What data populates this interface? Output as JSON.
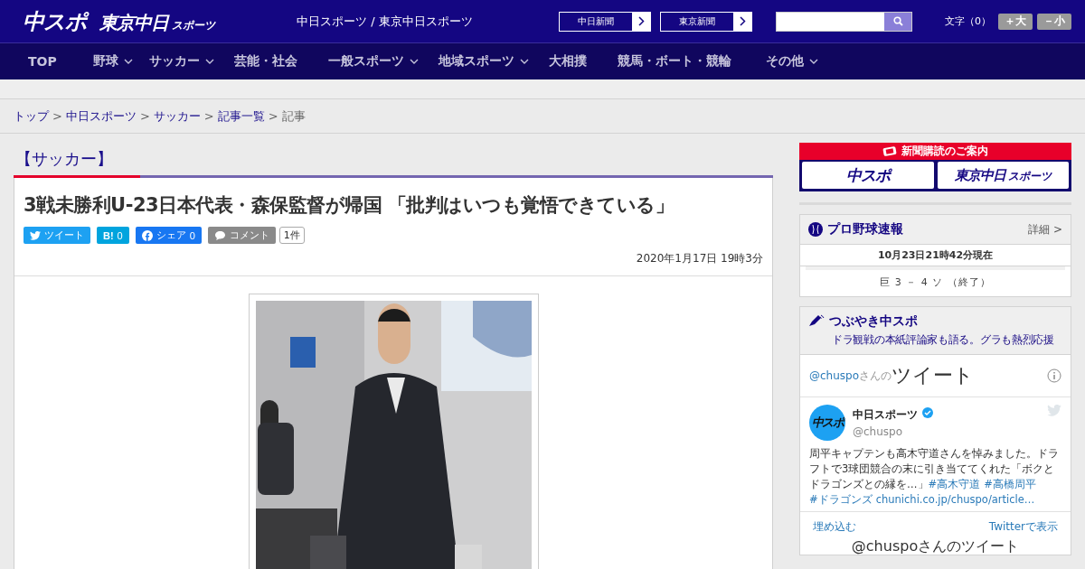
{
  "header": {
    "logos": [
      {
        "main": "中スポ"
      },
      {
        "main": "東京中日",
        "sub": "スポーツ"
      }
    ],
    "site_title": "中日スポーツ / 東京中日スポーツ",
    "paper_links": [
      "中日新聞",
      "東京新聞"
    ],
    "font_size": {
      "label": "文字（0）",
      "buttons": [
        "＋大",
        "－小"
      ]
    }
  },
  "nav": [
    {
      "label": "TOP",
      "dropdown": false
    },
    {
      "label": "野球",
      "dropdown": true
    },
    {
      "label": "サッカー",
      "dropdown": true
    },
    {
      "label": "芸能・社会",
      "dropdown": false
    },
    {
      "label": "一般スポーツ",
      "dropdown": true
    },
    {
      "label": "地域スポーツ",
      "dropdown": true
    },
    {
      "label": "大相撲",
      "dropdown": false
    },
    {
      "label": "競馬・ボート・競輪",
      "dropdown": false
    },
    {
      "label": "その他",
      "dropdown": true
    }
  ],
  "breadcrumb": {
    "separator": ">",
    "items": [
      {
        "label": "トップ",
        "link": true
      },
      {
        "label": "中日スポーツ",
        "link": true
      },
      {
        "label": "サッカー",
        "link": true
      },
      {
        "label": "記事一覧",
        "link": true
      },
      {
        "label": "記事",
        "link": false
      }
    ]
  },
  "article": {
    "category": "【サッカー】",
    "title": "3戦未勝利U-23日本代表・森保監督が帰国 「批判はいつも覚悟できている」",
    "share": [
      {
        "kind": "tweet",
        "label": "ツイート"
      },
      {
        "kind": "hatena",
        "label": "B!",
        "count": "0"
      },
      {
        "kind": "facebook",
        "label": "シェア",
        "count": "0"
      },
      {
        "kind": "comment",
        "label": "コメント",
        "count": "1件"
      }
    ],
    "date": "2020年1月17日 19時3分"
  },
  "sidebar": {
    "subscribe": {
      "title": "新聞購読のご案内",
      "logos": [
        {
          "main": "中スポ"
        },
        {
          "main": "東京中日",
          "sub": "スポーツ"
        }
      ]
    },
    "baseball": {
      "title": "プロ野球速報",
      "more": "詳細 >",
      "updated": "10月23日21時42分現在",
      "games": [
        "巨 3 － 4 ソ （終了）"
      ]
    },
    "tweets": {
      "title": "つぶやき中スポ",
      "subtitle": "ドラ観戦の本紙評論家も語る。グラも熱烈応援",
      "timeline": {
        "user": "@chuspo",
        "suffix": "さんの",
        "title": "ツイート"
      },
      "tweet": {
        "avatar_text": "中スポ",
        "name": "中日スポーツ",
        "handle": "@chuspo",
        "body": [
          {
            "text": "周平キャプテンも高木守道さんを悼みました。ドラフトで3球団競合の末に引き当ててくれた「ボクとドラゴンズとの縁を…」",
            "link": false
          },
          {
            "text": "#高木守道",
            "link": true
          },
          {
            "text": "#高橋周平",
            "link": true
          },
          {
            "text": "#ドラゴンズ",
            "link": true
          },
          {
            "text": "chunichi.co.jp/chuspo/article…",
            "link": true
          }
        ]
      },
      "footer_links": [
        "埋め込む",
        "Twitterで表示"
      ],
      "next_heading": "@chuspoさんのツイート"
    }
  }
}
